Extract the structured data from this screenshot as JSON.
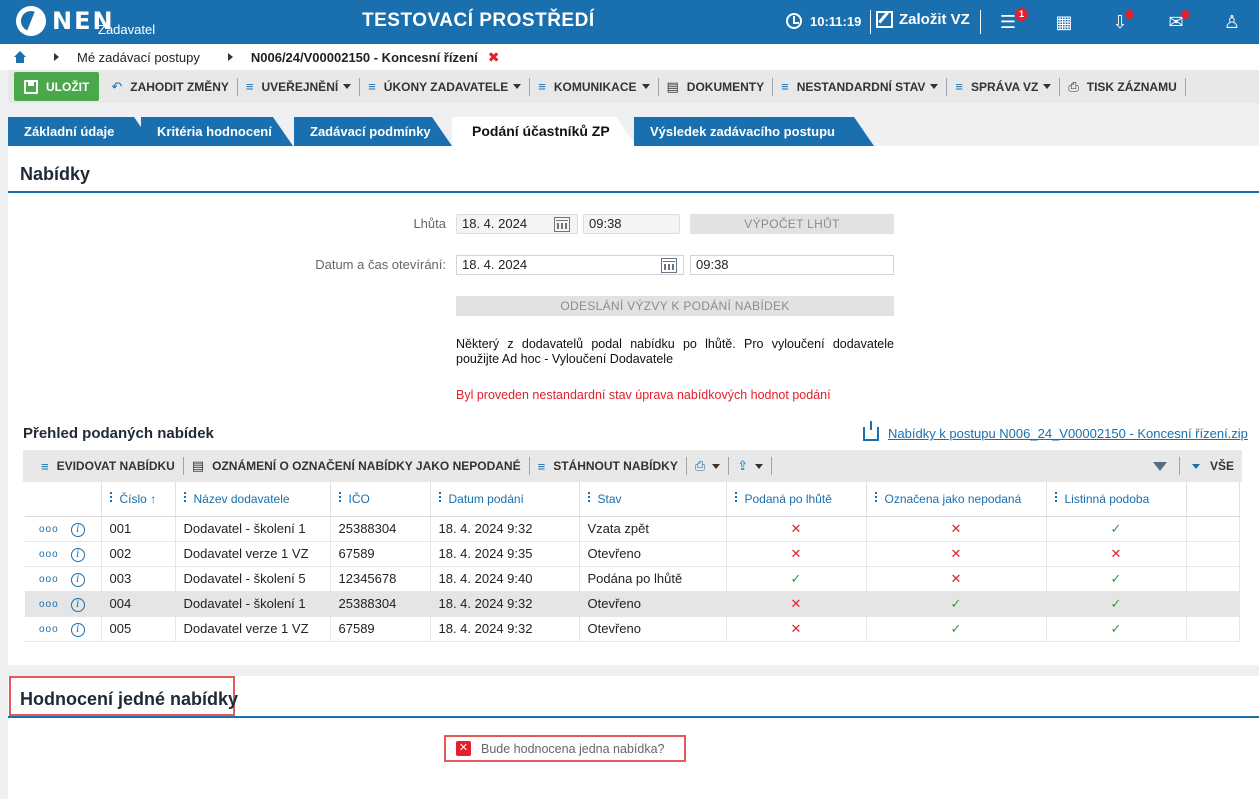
{
  "header": {
    "logo": "NEN",
    "logo_sub": "Zadavatel",
    "env_title": "TESTOVACÍ PROSTŘEDÍ",
    "clock": "10:11:19",
    "new_vz": "Založit VZ",
    "menu_badge": "1",
    "icons": [
      "menu-icon",
      "calculator-icon",
      "inbox-icon",
      "mail-icon",
      "user-icon"
    ]
  },
  "breadcrumb": {
    "items": [
      "Mé zadávací postupy",
      "N006/24/V00002150 - Koncesní řízení"
    ],
    "close": "✖"
  },
  "toolbar": {
    "save": "ULOŽIT",
    "discard": "ZAHODIT ZMĚNY",
    "publish": "UVEŘEJNĚNÍ",
    "actions": "ÚKONY ZADAVATELE",
    "communication": "KOMUNIKACE",
    "documents": "DOKUMENTY",
    "nonstandard": "NESTANDARDNÍ STAV",
    "admin": "SPRÁVA VZ",
    "print": "TISK ZÁZNAMU"
  },
  "tabs": [
    {
      "label": "Základní údaje"
    },
    {
      "label": "Kritéria hodnocení"
    },
    {
      "label": "Zadávací podmínky"
    },
    {
      "label": "Podání účastníků ZP",
      "active": true
    },
    {
      "label": "Výsledek zadávacího postupu"
    }
  ],
  "offers": {
    "title": "Nabídky",
    "deadline_label": "Lhůta",
    "deadline_date": "18. 4. 2024",
    "deadline_time": "09:38",
    "calc_button": "VÝPOČET LHŮT",
    "opening_label": "Datum a čas otevírání:",
    "opening_date": "18. 4. 2024",
    "opening_time": "09:38",
    "send_button": "ODESLÁNÍ VÝZVY K PODÁNÍ NABÍDEK",
    "note": "Některý z dodavatelů podal nabídku po lhůtě. Pro vyloučení dodavatele použijte Ad hoc - Vyloučení Dodavatele",
    "warning": "Byl proveden nestandardní stav úprava nabídkových hodnot podání"
  },
  "overview": {
    "title": "Přehled podaných nabídek",
    "zip_link": "Nabídky k postupu N006_24_V00002150 - Koncesní řízení.zip",
    "bar": {
      "register": "EVIDOVAT NABÍDKU",
      "notice": "OZNÁMENÍ O OZNAČENÍ NABÍDKY JAKO NEPODANÉ",
      "download": "STÁHNOUT NABÍDKY",
      "all": "VŠE"
    },
    "columns": [
      "Číslo",
      "Název dodavatele",
      "IČO",
      "Datum podání",
      "Stav",
      "Podaná po lhůtě",
      "Označena jako nepodaná",
      "Listinná podoba"
    ],
    "sort_indicator": "↑",
    "rows": [
      {
        "num": "001",
        "name": "Dodavatel - školení 1",
        "ico": "25388304",
        "date": "18. 4. 2024 9:32",
        "state": "Vzata zpět",
        "late": "✕",
        "unsubmitted": "✕",
        "paper": "✓",
        "selected": false
      },
      {
        "num": "002",
        "name": "Dodavatel verze 1 VZ",
        "ico": "67589",
        "date": "18. 4. 2024 9:35",
        "state": "Otevřeno",
        "late": "✕",
        "unsubmitted": "✕",
        "paper": "✕",
        "selected": false
      },
      {
        "num": "003",
        "name": "Dodavatel - školení 5",
        "ico": "12345678",
        "date": "18. 4. 2024 9:40",
        "state": "Podána po lhůtě",
        "late": "✓",
        "unsubmitted": "✕",
        "paper": "✓",
        "selected": false
      },
      {
        "num": "004",
        "name": "Dodavatel - školení 1",
        "ico": "25388304",
        "date": "18. 4. 2024 9:32",
        "state": "Otevřeno",
        "late": "✕",
        "unsubmitted": "✓",
        "paper": "✓",
        "selected": true
      },
      {
        "num": "005",
        "name": "Dodavatel verze 1 VZ",
        "ico": "67589",
        "date": "18. 4. 2024 9:32",
        "state": "Otevřeno",
        "late": "✕",
        "unsubmitted": "✓",
        "paper": "✓",
        "selected": false
      }
    ]
  },
  "single": {
    "title": "Hodnocení jedné nabídky",
    "checkbox_label": "Bude hodnocena jedna nabídka?",
    "checkbox_mark": "✕"
  },
  "colors": {
    "brand": "#1a6fae",
    "save": "#4aa74a",
    "error": "#e3202b",
    "ok": "#3a9a3a"
  }
}
